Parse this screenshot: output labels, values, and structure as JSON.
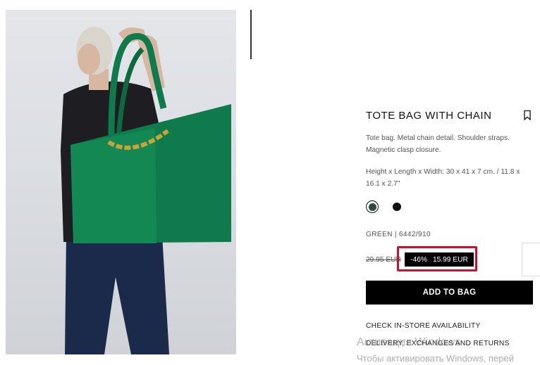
{
  "product": {
    "title": "TOTE BAG WITH CHAIN",
    "description": "Tote bag. Metal chain detail. Shoulder straps. Magnetic clasp closure.",
    "dimensions": "Height x Length x Width: 30 x 41 x 7 cm. / 11.8 x 16.1 x 2.7\"",
    "color_ref": "GREEN | 6442/910",
    "swatches": [
      {
        "name": "green",
        "color": "#2a4a3c",
        "selected": true
      },
      {
        "name": "black",
        "color": "#111111",
        "selected": false
      }
    ],
    "old_price": "29.95 EUR",
    "discount": "-46%",
    "price": "15.99 EUR",
    "add_to_bag": "ADD TO BAG",
    "check_store": "CHECK IN-STORE AVAILABILITY",
    "delivery": "DELIVERY, EXCHANGES AND RETURNS"
  },
  "colors": {
    "bag_green": "#0f7a4c",
    "highlight_red": "#c8102e"
  },
  "watermark": {
    "line1": "Активация Windows",
    "line2": "Чтобы активировать Windows, перей"
  }
}
